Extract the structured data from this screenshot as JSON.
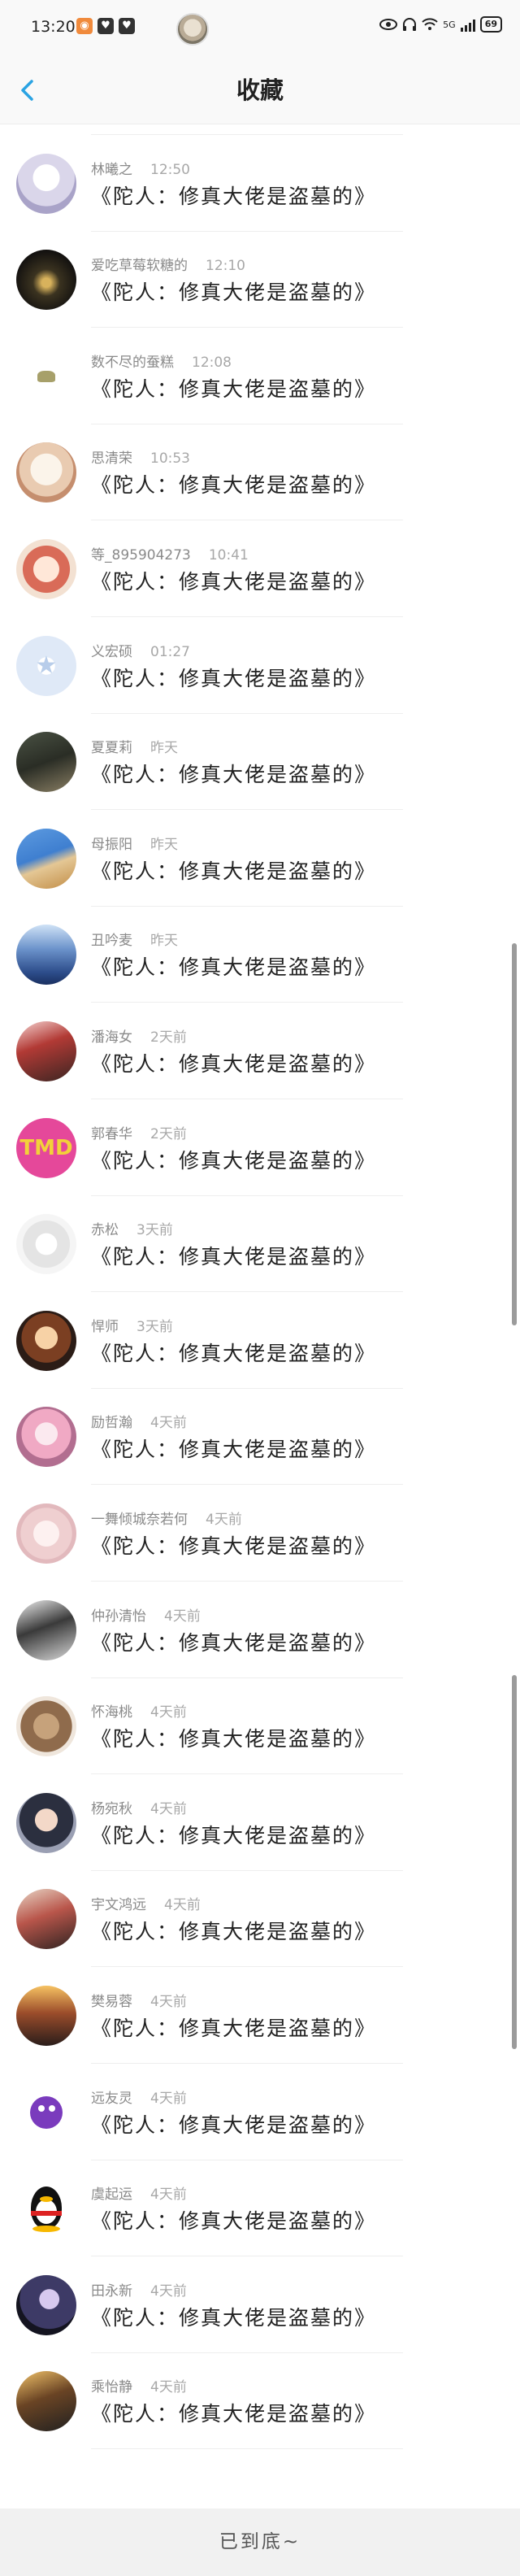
{
  "status_bar": {
    "time": "13:20",
    "network": "5G",
    "battery": "69"
  },
  "nav": {
    "title": "收藏"
  },
  "items": [
    {
      "name": "",
      "time": "",
      "message": "《陀人：修真大佬是盗墓的》"
    },
    {
      "name": "林曦之",
      "time": "12:50",
      "message": "《陀人：修真大佬是盗墓的》"
    },
    {
      "name": "爱吃草莓软糖的",
      "time": "12:10",
      "message": "《陀人：修真大佬是盗墓的》"
    },
    {
      "name": "数不尽的蚕糕",
      "time": "12:08",
      "message": "《陀人：修真大佬是盗墓的》"
    },
    {
      "name": "思清荣",
      "time": "10:53",
      "message": "《陀人：修真大佬是盗墓的》"
    },
    {
      "name": "等_895904273",
      "time": "10:41",
      "message": "《陀人：修真大佬是盗墓的》"
    },
    {
      "name": "义宏硕",
      "time": "01:27",
      "message": "《陀人：修真大佬是盗墓的》"
    },
    {
      "name": "夏夏莉",
      "time": "昨天",
      "message": "《陀人：修真大佬是盗墓的》"
    },
    {
      "name": "母振阳",
      "time": "昨天",
      "message": "《陀人：修真大佬是盗墓的》"
    },
    {
      "name": "丑吟麦",
      "time": "昨天",
      "message": "《陀人：修真大佬是盗墓的》"
    },
    {
      "name": "潘海女",
      "time": "2天前",
      "message": "《陀人：修真大佬是盗墓的》"
    },
    {
      "name": "郭春华",
      "time": "2天前",
      "message": "《陀人：修真大佬是盗墓的》"
    },
    {
      "name": "赤松",
      "time": "3天前",
      "message": "《陀人：修真大佬是盗墓的》"
    },
    {
      "name": "悍师",
      "time": "3天前",
      "message": "《陀人：修真大佬是盗墓的》"
    },
    {
      "name": "励哲瀚",
      "time": "4天前",
      "message": "《陀人：修真大佬是盗墓的》"
    },
    {
      "name": "一舞倾城奈若何",
      "time": "4天前",
      "message": "《陀人：修真大佬是盗墓的》"
    },
    {
      "name": "仲孙清怡",
      "time": "4天前",
      "message": "《陀人：修真大佬是盗墓的》"
    },
    {
      "name": "怀海桃",
      "time": "4天前",
      "message": "《陀人：修真大佬是盗墓的》"
    },
    {
      "name": "杨宛秋",
      "time": "4天前",
      "message": "《陀人：修真大佬是盗墓的》"
    },
    {
      "name": "宇文鸿远",
      "time": "4天前",
      "message": "《陀人：修真大佬是盗墓的》"
    },
    {
      "name": "樊易蓉",
      "time": "4天前",
      "message": "《陀人：修真大佬是盗墓的》"
    },
    {
      "name": "远友灵",
      "time": "4天前",
      "message": "《陀人：修真大佬是盗墓的》"
    },
    {
      "name": "虞起运",
      "time": "4天前",
      "message": "《陀人：修真大佬是盗墓的》"
    },
    {
      "name": "田永新",
      "time": "4天前",
      "message": "《陀人：修真大佬是盗墓的》"
    },
    {
      "name": "乘怡静",
      "time": "4天前",
      "message": "《陀人：修真大佬是盗墓的》"
    }
  ],
  "footer": {
    "text": "已到底~"
  },
  "colors": {
    "accent": "#2aa3e3",
    "text_primary": "#222222",
    "text_secondary": "#8a8a8a"
  }
}
